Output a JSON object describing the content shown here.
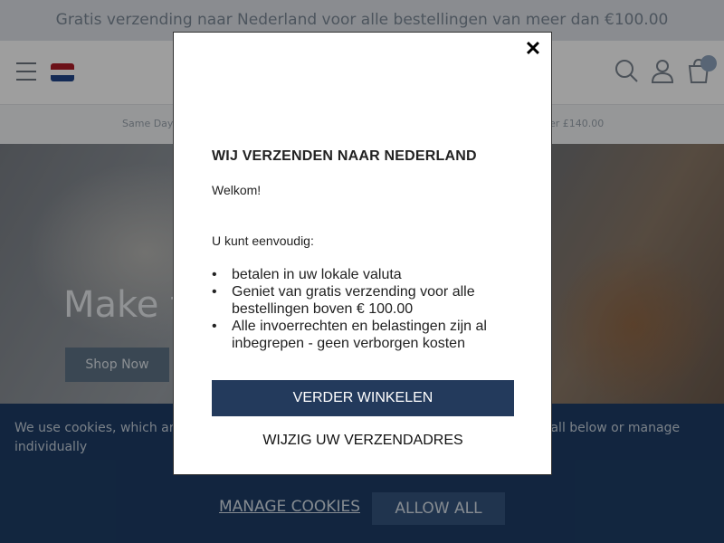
{
  "announcement": "Gratis verzending naar Nederland voor alle bestellingen van meer dan €100.00",
  "header": {
    "menu_icon": "hamburger-icon",
    "flag": "netherlands-flag",
    "flag_colors": [
      "#ae1c28",
      "#ffffff",
      "#21468b"
    ],
    "icons": [
      "search-icon",
      "account-icon",
      "bag-icon"
    ]
  },
  "usp": {
    "left": "Same Day",
    "right": "er £140.00"
  },
  "hero": {
    "title": "Make t",
    "button": "Shop Now"
  },
  "cookie": {
    "text_start": "We use cookies, which are s",
    "text_end": "w all below or manage",
    "text_line2": "individually",
    "manage_label": "MANAGE COOKIES",
    "allow_label": "ALLOW ALL",
    "bg_color": "#1d3d66"
  },
  "modal": {
    "close": "✕",
    "title": "WIJ VERZENDEN NAAR NEDERLAND",
    "welcome": "Welkom!",
    "intro": "U kunt eenvoudig:",
    "benefits": [
      "betalen in uw lokale valuta",
      "Geniet van gratis verzending voor alle bestellingen boven € 100.00",
      "Alle invoerrechten en belastingen zijn al inbegrepen - geen verborgen kosten"
    ],
    "primary_button": "VERDER WINKELEN",
    "secondary_button": "WIJZIG UW VERZENDADRES",
    "accent_color": "#233a5c"
  }
}
